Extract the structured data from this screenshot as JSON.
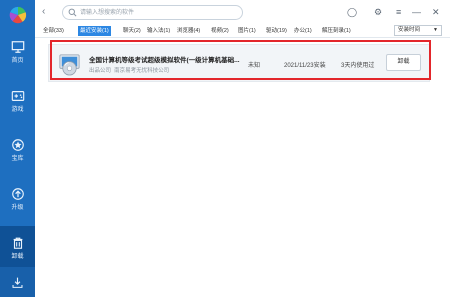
{
  "sidebar": {
    "items": [
      {
        "label": "首页",
        "icon": "monitor-icon"
      },
      {
        "label": "游戏",
        "icon": "gamepad-icon"
      },
      {
        "label": "宝库",
        "icon": "treasure-icon"
      },
      {
        "label": "升级",
        "icon": "upgrade-icon"
      },
      {
        "label": "卸载",
        "icon": "trash-icon",
        "active": true
      }
    ]
  },
  "search": {
    "placeholder": "请输入想搜索的软件"
  },
  "tabs": [
    {
      "label": "全部(33)"
    },
    {
      "label": "最近安装(1)",
      "active": true
    },
    {
      "label": "聊天(2)"
    },
    {
      "label": "输入法(1)"
    },
    {
      "label": "浏览器(4)"
    },
    {
      "label": "视频(2)"
    },
    {
      "label": "图片(1)"
    },
    {
      "label": "驱动(19)"
    },
    {
      "label": "办公(1)"
    },
    {
      "label": "解压刻录(1)"
    }
  ],
  "sort": {
    "selected": "安装时间"
  },
  "apps": [
    {
      "title": "全国计算机等级考试超级模拟软件(一级计算机基础...",
      "publisher": "出品公司",
      "company": "南京易考无忧科技公司",
      "usage_freq": "未知",
      "install_date": "2021/11/23安装",
      "last_used": "3天内使用过",
      "action": "卸载"
    }
  ],
  "colors": {
    "sidebar": "#1e6fc0",
    "sidebar_active": "#0f5196",
    "accent": "#2c87e3",
    "highlight": "#e3262b"
  }
}
